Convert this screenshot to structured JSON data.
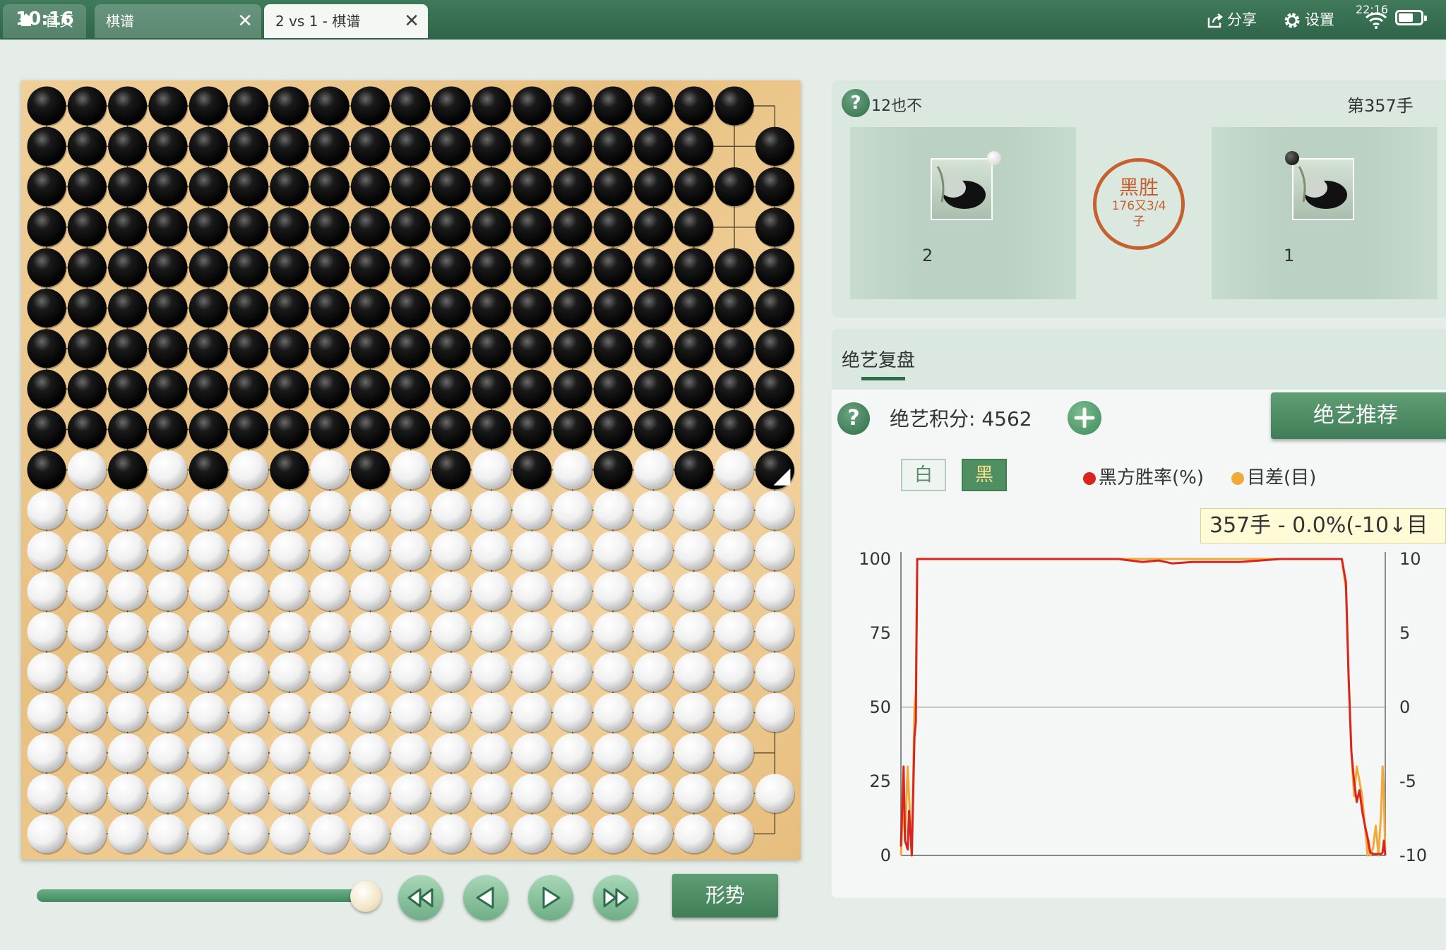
{
  "tabs": {
    "clock": "10:16",
    "home_label": "首页",
    "tab1_label": "棋谱",
    "tab2_label": "2 vs 1 - 棋谱",
    "close_glyph": "✕"
  },
  "toolbar": {
    "share_label": "分享",
    "settings_label": "设置",
    "status_time": "22:16"
  },
  "board": {
    "size": 19,
    "last_move": {
      "row": 9,
      "col": 18
    },
    "rows": [
      "BBBBBBBBBBBBBBBBBB.",
      "BBBBBBBBBBBBBBBBB.B",
      "BBBBBBBBBBBBBBBBBBB",
      "BBBBBBBBBBBBBBBBB.B",
      "BBBBBBBBBBBBBBBBBBB",
      "BBBBBBBBBBBBBBBBBBB",
      "BBBBBBBBBBBBBBBBBBB",
      "BBBBBBBBBBBBBBBBBBB",
      "BBBBBBBBBBBBBBBBBBB",
      "BWBWBWBWBWBWBWBWBWB",
      "WWWWWWWWWWWWWWWWWWW",
      "WWWWWWWWWWWWWWWWWWW",
      "WWWWWWWWWWWWWWWWWWW",
      "WWWWWWWWWWWWWWWWWWW",
      "WWWWWWWWWWWWWWWWWWW",
      "WWWWWWWWWWWWWWWWWWW",
      "WWWWWWWWWWWWWWWWWW.",
      "WWWWWWWWWWWWWWWWWWW",
      "WWWWWWWWWWWWWWWWWW."
    ]
  },
  "playback": {
    "progress": 1.0,
    "shape_label": "形势"
  },
  "game_info": {
    "player_name": "12也不",
    "move_label": "第357手",
    "white_player_count": "2",
    "black_player_count": "1",
    "result_main": "黑胜",
    "result_detail": "176又3/4",
    "result_unit": "子"
  },
  "analysis": {
    "title": "绝艺复盘",
    "score_label": "绝艺积分: 4562",
    "recommend_label": "绝艺推荐",
    "toggle_white": "白",
    "toggle_black": "黑",
    "legend_winrate": "黑方胜率(%)",
    "legend_diff": "目差(目)",
    "tooltip": "357手 - 0.0%(-10↓目",
    "colors": {
      "winrate": "#d8251e",
      "diff": "#f2a93b"
    }
  },
  "chart_data": {
    "type": "line",
    "x_range": [
      0,
      357
    ],
    "y_left_ticks": [
      "100",
      "75",
      "50",
      "25",
      "0"
    ],
    "y_right_ticks": [
      "10",
      "5",
      "0",
      "-5",
      "-10"
    ],
    "ylim_left": [
      0,
      100
    ],
    "ylim_right": [
      -10,
      10
    ],
    "series": [
      {
        "name": "黑方胜率(%)",
        "axis": "left",
        "x": [
          0,
          2,
          3,
          5,
          6,
          8,
          10,
          11,
          12,
          14,
          16,
          18,
          20,
          40,
          80,
          120,
          160,
          178,
          190,
          200,
          215,
          230,
          250,
          280,
          300,
          320,
          325,
          328,
          330,
          332,
          334,
          336,
          338,
          340,
          342,
          344,
          345,
          346,
          348,
          350,
          352,
          354,
          355,
          356,
          357
        ],
        "y": [
          3,
          30,
          5,
          2,
          15,
          0,
          40,
          45,
          100,
          100,
          100,
          100,
          100,
          100,
          100,
          100,
          100,
          99,
          99.5,
          98.5,
          99,
          99,
          99,
          100,
          100,
          100,
          100,
          92,
          60,
          35,
          25,
          18,
          22,
          15,
          10,
          6,
          3,
          1,
          0.5,
          0.5,
          0.5,
          0.5,
          1,
          5,
          0
        ]
      },
      {
        "name": "目差(目)",
        "axis": "right",
        "x": [
          0,
          2,
          3,
          5,
          8,
          10,
          11,
          12,
          20,
          100,
          200,
          300,
          320,
          325,
          328,
          330,
          332,
          334,
          336,
          338,
          340,
          342,
          344,
          345,
          346,
          348,
          350,
          352,
          354,
          355,
          356,
          357
        ],
        "y": [
          -10,
          -6,
          -9,
          -4,
          -10,
          0,
          1,
          10,
          10,
          10,
          10,
          10,
          10,
          10,
          8,
          2,
          -3,
          -6,
          -4,
          -5,
          -6,
          -8,
          -10,
          -9,
          -10,
          -9.5,
          -8,
          -10,
          -7,
          -4,
          -6,
          -10
        ]
      }
    ]
  }
}
